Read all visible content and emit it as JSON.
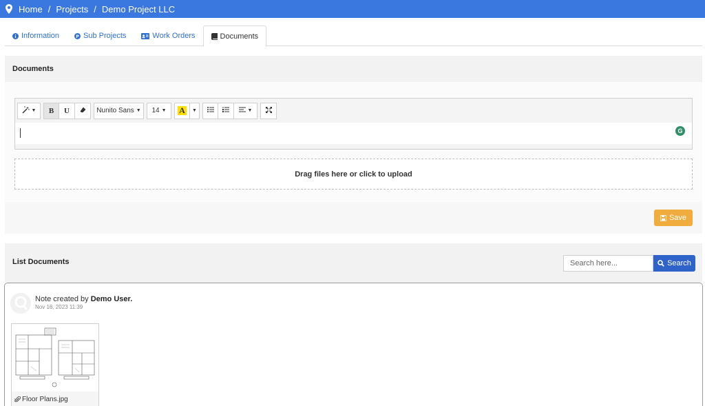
{
  "breadcrumb": {
    "home": "Home",
    "projects": "Projects",
    "current": "Demo Project LLC",
    "separator": "/"
  },
  "tabs": [
    {
      "label": "Information",
      "icon": "info-circle-icon"
    },
    {
      "label": "Sub Projects",
      "icon": "p-circle-icon"
    },
    {
      "label": "Work Orders",
      "icon": "id-card-icon"
    },
    {
      "label": "Documents",
      "icon": "book-icon",
      "active": true
    }
  ],
  "documents": {
    "title": "Documents",
    "toolbar": {
      "font_family": "Nunito Sans",
      "font_size": "14",
      "highlight_letter": "A",
      "bold": "B",
      "underline": "U"
    },
    "dropzone": "Drag files here or click to upload",
    "save_label": "Save",
    "grammarly_letter": "G"
  },
  "list": {
    "title": "List Documents",
    "search_placeholder": "Search here...",
    "search_label": "Search",
    "notes": [
      {
        "prefix": "Note created by ",
        "author": "Demo User.",
        "date": "Nov 16, 2023 11:39",
        "attachment": "Floor Plans.jpg"
      }
    ]
  },
  "colors": {
    "topbar": "#3a78e0",
    "link": "#2f6fd4",
    "save": "#f0ad3e",
    "search": "#2f63c9"
  }
}
